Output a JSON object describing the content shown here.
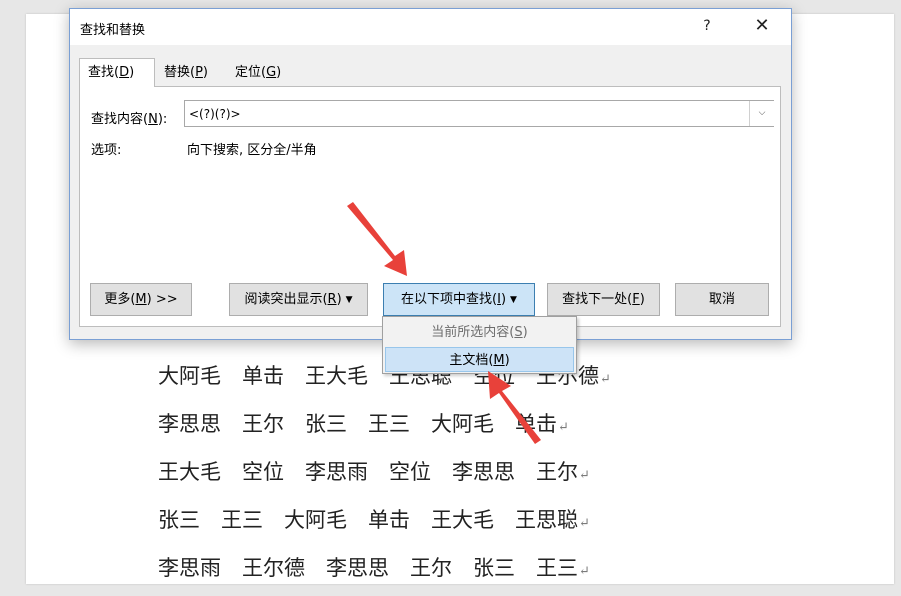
{
  "document": {
    "lines": [
      "大阿毛　单击　王大毛　王思聪　空位　王尔德",
      "李思思　王尔　张三　王三　大阿毛　单击",
      "王大毛　空位　李思雨　空位　李思思　王尔",
      "张三　王三　大阿毛　单击　王大毛　王思聪",
      "李思雨　王尔德　李思思　王尔　张三　王三"
    ],
    "paragraph_mark": "↵"
  },
  "dialog": {
    "title": "查找和替换",
    "help_label": "?",
    "close_label": "✕",
    "tabs": {
      "find": {
        "text": "查找(",
        "key": "D",
        "end": ")"
      },
      "replace": {
        "text": "替换(",
        "key": "P",
        "end": ")"
      },
      "goto": {
        "text": "定位(",
        "key": "G",
        "end": ")"
      }
    },
    "find_label": {
      "text": "查找内容(",
      "key": "N",
      "end": "):"
    },
    "find_value": "<(?)(?)>",
    "options_label": "选项:",
    "options_value": "向下搜索, 区分全/半角",
    "buttons": {
      "more": {
        "text": "更多(",
        "key": "M",
        "end": ") >>"
      },
      "highlight": {
        "text": "阅读突出显示(",
        "key": "R",
        "end": ")"
      },
      "find_in": {
        "text": "在以下项中查找(",
        "key": "I",
        "end": ")"
      },
      "find_next": {
        "text": "查找下一处(",
        "key": "F",
        "end": ")"
      },
      "cancel": "取消"
    },
    "find_in_menu": [
      {
        "text": "当前所选内容(",
        "key": "S",
        "end": ")"
      },
      {
        "text": "主文档(",
        "key": "M",
        "end": ")"
      }
    ]
  },
  "annotation_color": "#e8413a"
}
